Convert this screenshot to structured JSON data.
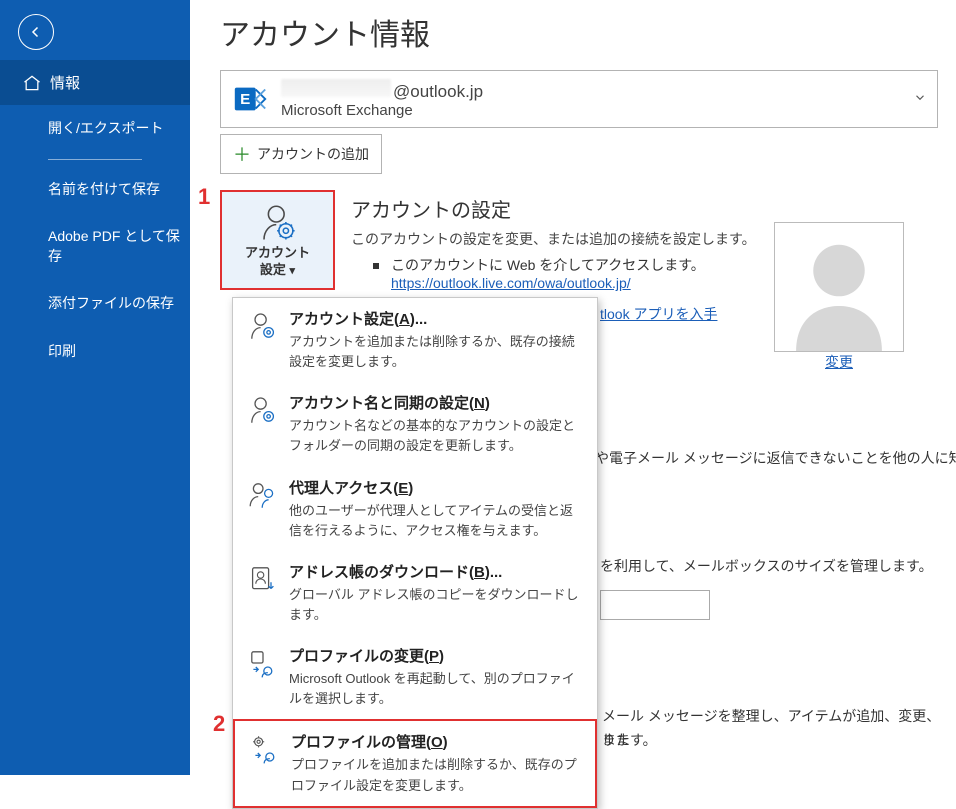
{
  "sidebar": {
    "items": [
      {
        "label": "情報",
        "active": true,
        "icon": "home"
      },
      {
        "label": "開く/エクスポート"
      },
      {
        "label": "名前を付けて保存"
      },
      {
        "label": "Adobe PDF として保存"
      },
      {
        "label": "添付ファイルの保存"
      },
      {
        "label": "印刷"
      }
    ]
  },
  "page_title": "アカウント情報",
  "account": {
    "email_suffix": "@outlook.jp",
    "service": "Microsoft Exchange"
  },
  "add_account_label": "アカウントの追加",
  "annotations": {
    "one": "1",
    "two": "2"
  },
  "account_settings_btn": {
    "line1": "アカウント",
    "line2": "設定",
    "caret": "⌄"
  },
  "section_account": {
    "title": "アカウントの設定",
    "desc": "このアカウントの設定を変更、または追加の接続を設定します。",
    "bullet": "このアカウントに Web を介してアクセスします。",
    "link_url": "https://outlook.live.com/owa/outlook.jp/"
  },
  "app_link_tail": "tlook アプリを入手",
  "profile_change_label": "変更",
  "menu": {
    "items": [
      {
        "title_pre": "アカウント設定(",
        "mn": "A",
        "title_post": ")...",
        "desc": "アカウントを追加または削除するか、既存の接続設定を変更します。"
      },
      {
        "title_pre": "アカウント名と同期の設定(",
        "mn": "N",
        "title_post": ")",
        "desc": "アカウント名などの基本的なアカウントの設定とフォルダーの同期の設定を更新します。"
      },
      {
        "title_pre": "代理人アクセス(",
        "mn": "E",
        "title_post": ")",
        "desc": "他のユーザーが代理人としてアイテムの受信と返信を行えるように、アクセス権を与えます。"
      },
      {
        "title_pre": "アドレス帳のダウンロード(",
        "mn": "B",
        "title_post": ")...",
        "desc": "グローバル アドレス帳のコピーをダウンロードします。"
      },
      {
        "title_pre": "プロファイルの変更(",
        "mn": "P",
        "title_post": ")",
        "desc": "Microsoft Outlook を再起動して、別のプロファイルを選択します。"
      },
      {
        "title_pre": "プロファイルの管理(",
        "mn": "O",
        "title_post": ")",
        "desc": "プロファイルを追加または削除するか、既存のプロファイル設定を変更します。",
        "highlight": true
      }
    ]
  },
  "peek": {
    "auto1": "や電子メール メッセージに返信できないことを他の人に知",
    "auto2": "",
    "mb": "を利用して、メールボックスのサイズを管理します。",
    "rules1": "メール メッセージを整理し、アイテムが追加、変更、また",
    "rules2": "ります。"
  }
}
